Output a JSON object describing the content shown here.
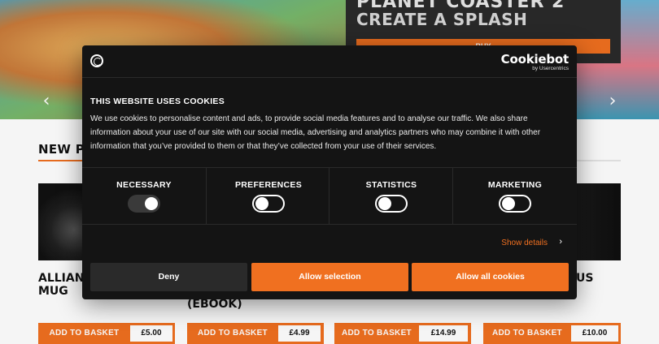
{
  "hero": {
    "promo_title_top": "PLANET COASTER 2",
    "promo_title": "CREATE A SPLASH",
    "promo_button": "BUY",
    "prev_arrow": "‹",
    "next_arrow": "›"
  },
  "products": {
    "section_title": "NEW PRODUCTS",
    "items": [
      {
        "name": "ALLIANCE MUG",
        "button": "ADD TO BASKET",
        "price": "£5.00"
      },
      {
        "name": "(EBOOK)",
        "button": "ADD TO BASKET",
        "price": "£4.99"
      },
      {
        "name": "",
        "button": "ADD TO BASKET",
        "price": "£14.99"
      },
      {
        "name": "US",
        "button": "ADD TO BASKET",
        "price": "£10.00"
      }
    ]
  },
  "cookie_dialog": {
    "brand_name": "Cookiebot",
    "brand_sub": "by Usercentrics",
    "title": "THIS WEBSITE USES COOKIES",
    "text": "We use cookies to personalise content and ads, to provide social media features and to analyse our traffic. We also share information about your use of our site with our social media, advertising and analytics partners who may combine it with other information that you’ve provided to them or that they’ve collected from your use of their services.",
    "categories": [
      {
        "label": "NECESSARY",
        "state": "on-disabled"
      },
      {
        "label": "PREFERENCES",
        "state": "off"
      },
      {
        "label": "STATISTICS",
        "state": "off"
      },
      {
        "label": "MARKETING",
        "state": "off"
      }
    ],
    "show_details": "Show details",
    "details_chevron": "›",
    "deny": "Deny",
    "allow_selection": "Allow selection",
    "allow_all": "Allow all cookies"
  },
  "colors": {
    "accent": "#f07020",
    "dialog_bg": "#141414"
  }
}
